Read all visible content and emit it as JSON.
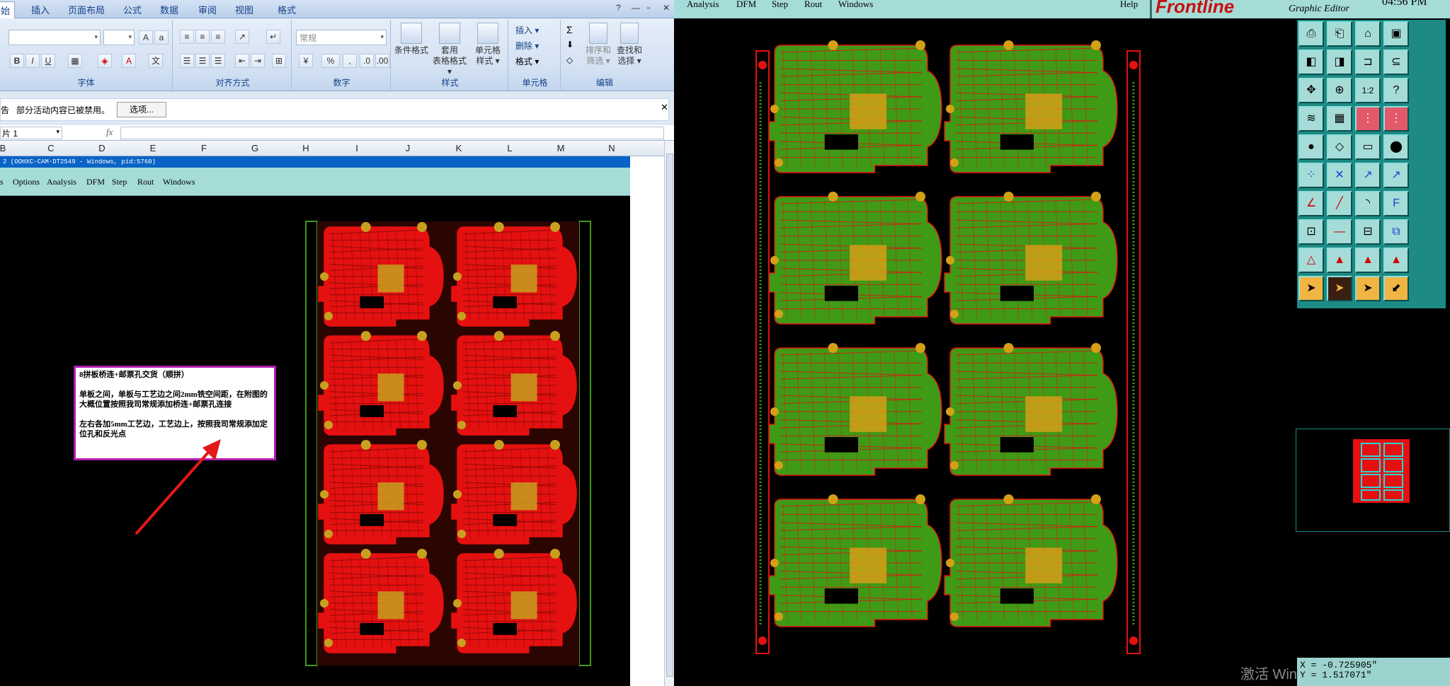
{
  "excel": {
    "tabs": [
      "始",
      "插入",
      "页面布局",
      "公式",
      "数据",
      "审阅",
      "视图",
      "格式"
    ],
    "active_tab": "始",
    "window_controls": [
      "?",
      "—",
      "▫",
      "✕"
    ],
    "groups": {
      "font": "字体",
      "alignment": "对齐方式",
      "number": "数字",
      "styles": "样式",
      "cells": "单元格",
      "editing": "编辑"
    },
    "number_format": "常规",
    "style_buttons": [
      {
        "label1": "条件格式",
        "label2": ""
      },
      {
        "label1": "套用",
        "label2": "表格格式 ▾"
      },
      {
        "label1": "单元格",
        "label2": "样式 ▾"
      }
    ],
    "cell_buttons": [
      "插入 ▾",
      "删除 ▾",
      "格式 ▾"
    ],
    "edit_buttons": [
      {
        "label1": "排序和",
        "label2": "筛选 ▾"
      },
      {
        "label1": "查找和",
        "label2": "选择 ▾"
      }
    ],
    "security": {
      "prefix": "告",
      "message": "部分活动内容已被禁用。",
      "options_button": "选项..."
    },
    "name_box": "片 1",
    "fx_label": "fx",
    "columns": [
      "B",
      "C",
      "D",
      "E",
      "F",
      "G",
      "H",
      "I",
      "J",
      "K",
      "L",
      "M",
      "N"
    ],
    "embedded": {
      "title": "2 (OOHXC-CAM-DT2549 - Windows, pid:5760)",
      "menu": [
        "s",
        "Options",
        "Analysis",
        "DFM",
        "Step",
        "Rout",
        "Windows"
      ]
    },
    "note": {
      "line1": "8拼板桥连+邮票孔交货（顺拼）",
      "line2": "单板之间，单板与工艺边之间2mm铣空间距，在附图的大概位置按照我司常规添加桥连+邮票孔连接",
      "line3": "左右各加5mm工艺边，工艺边上，按照我司常规添加定位孔和反光点"
    }
  },
  "genesis": {
    "menu": [
      "Analysis",
      "DFM",
      "Step",
      "Rout",
      "Windows"
    ],
    "help": "Help",
    "logo": "Frontline",
    "subtitle": "Graphic Editor",
    "clock": "04:56 PM",
    "coords": {
      "x": "X = -0.725905\"",
      "y": "Y =  1.517071\""
    },
    "watermark": "激活 Windows",
    "colors": {
      "board_green": "#3f9a16",
      "board_red": "#e51010",
      "panel_cyan": "#a6dcd8"
    }
  }
}
